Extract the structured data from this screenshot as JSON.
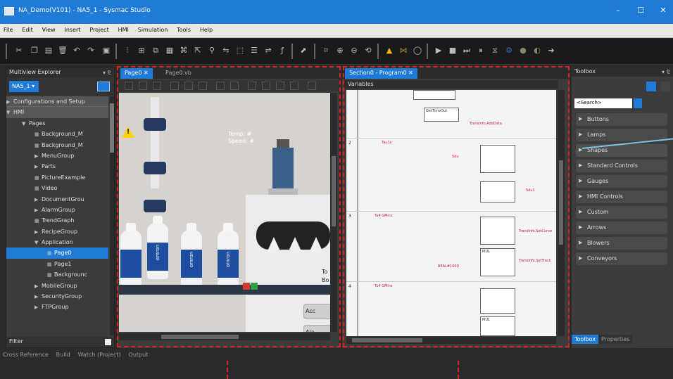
{
  "window": {
    "title": "NA_Demo(V101) - NA5_1 - Sysmac Studio",
    "min": "–",
    "max": "☐",
    "close": "✕"
  },
  "menu": [
    "File",
    "Edit",
    "View",
    "Insert",
    "Project",
    "HMI",
    "Simulation",
    "Tools",
    "Help"
  ],
  "explorer": {
    "title": "Multiview Explorer",
    "pin": "▾ ⅊",
    "device": "NA5_1 ▾",
    "items": [
      {
        "label": "Configurations and Setup"
      },
      {
        "label": "HMI"
      },
      {
        "label": "Pages"
      },
      {
        "label": "Background_M"
      },
      {
        "label": "Background_M"
      },
      {
        "label": "MenuGroup"
      },
      {
        "label": "Parts"
      },
      {
        "label": "PictureExample"
      },
      {
        "label": "Video"
      },
      {
        "label": "DocumentGrou"
      },
      {
        "label": "AlarmGroup"
      },
      {
        "label": "TrendGraph"
      },
      {
        "label": "RecipeGroup"
      },
      {
        "label": "Application"
      },
      {
        "label": "Page0"
      },
      {
        "label": "Page1"
      },
      {
        "label": "Backgrounc"
      },
      {
        "label": "MobileGroup"
      },
      {
        "label": "SecurityGroup"
      },
      {
        "label": "FTPGroup"
      }
    ],
    "filter": "Filter"
  },
  "center": {
    "tab_active": "Page0 ✕",
    "tab_inactive": "Page0.vb",
    "temp": "Temp: #",
    "speed": "Speed: #",
    "brand": "omron",
    "label_to": "To",
    "label_bo": "Bo",
    "btn_acc": "Acc",
    "btn_ala": "Ala"
  },
  "ladder": {
    "tab": "Section0 - Program0 ✕",
    "variables": "Variables",
    "rungs": [
      "2",
      "3",
      "4"
    ],
    "blocks": {
      "getmin": "GetTimeOut",
      "addr": "TransInfo.AddData",
      "tau": "Tau1s",
      "sub1": "Sdu",
      "sub2": "Sdu1",
      "tm1": "Tu4 GMins",
      "tm2": "Tu4 GMins",
      "sd": "TransInfo.SetCurve",
      "mul": "MUL",
      "real": "REAL#1000",
      "set": "TransInfo.SetTrack"
    }
  },
  "toolbox": {
    "title": "Toolbox",
    "search": "<Search>",
    "items": [
      "Buttons",
      "Lamps",
      "Shapes",
      "Standard Controls",
      "Gauges",
      "HMI Controls",
      "Custom",
      "Arrows",
      "Blowers",
      "Conveyors"
    ],
    "tab_toolbox": "Toolbox",
    "tab_properties": "Properties"
  },
  "bottom": [
    "Cross Reference",
    "Build",
    "Watch (Project)",
    "Output"
  ],
  "accent": "#1f7bd6",
  "annotation_color": "#e02020"
}
